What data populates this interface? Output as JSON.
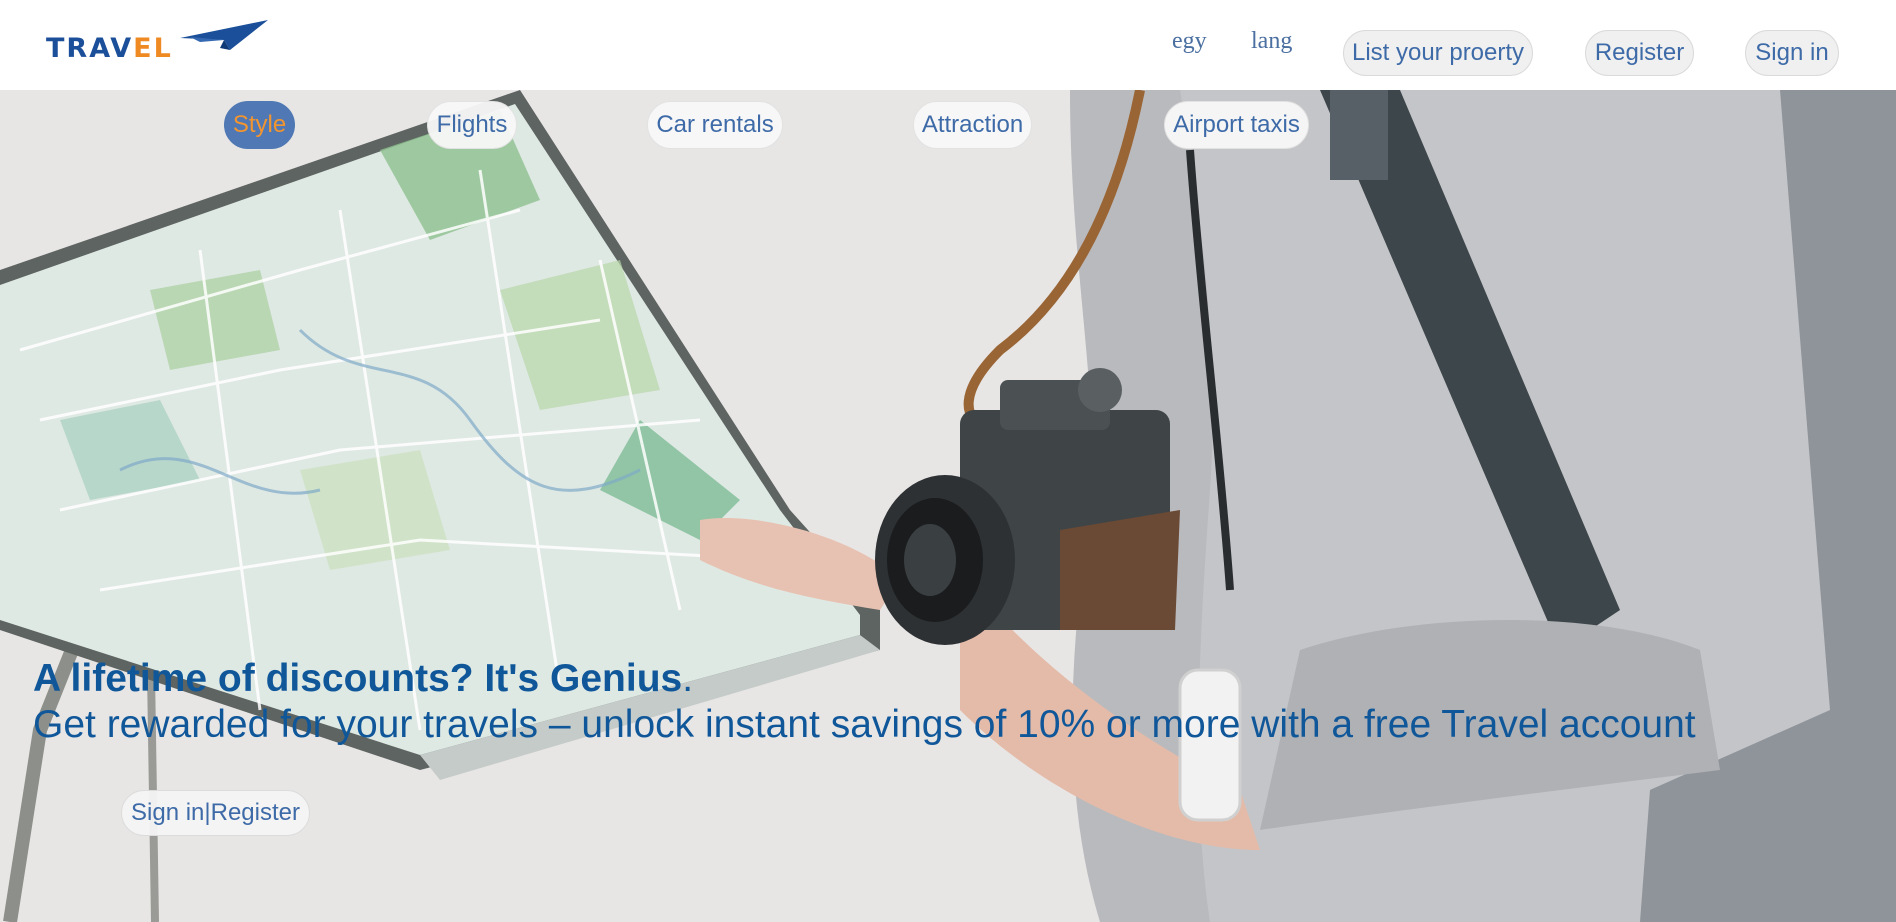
{
  "header": {
    "logo": {
      "text_main": "TRAV",
      "text_accent": "EL",
      "icon": "paper-plane-icon",
      "brand_color": "#1b4f9a",
      "accent_color": "#ef8a22"
    },
    "country": "egy",
    "language": "lang",
    "list_property_label": "List your proerty",
    "register_label": "Register",
    "sign_in_label": "Sign in"
  },
  "nav": {
    "items": [
      {
        "label": "Style",
        "active": true
      },
      {
        "label": "Flights",
        "active": false
      },
      {
        "label": "Car rentals",
        "active": false
      },
      {
        "label": "Attraction",
        "active": false
      },
      {
        "label": "Airport taxis",
        "active": false
      }
    ]
  },
  "hero": {
    "title": "A lifetime of discounts? It's Genius",
    "title_punct": ".",
    "subtitle": "Get rewarded for your travels – unlock instant savings of 10% or more with a free Travel account",
    "cta_label": "Sign in|Register"
  },
  "colors": {
    "text_blue": "#10579a",
    "link_blue": "#3e6ba8",
    "active_bg": "#4f78b4",
    "active_text": "#f3952f"
  }
}
